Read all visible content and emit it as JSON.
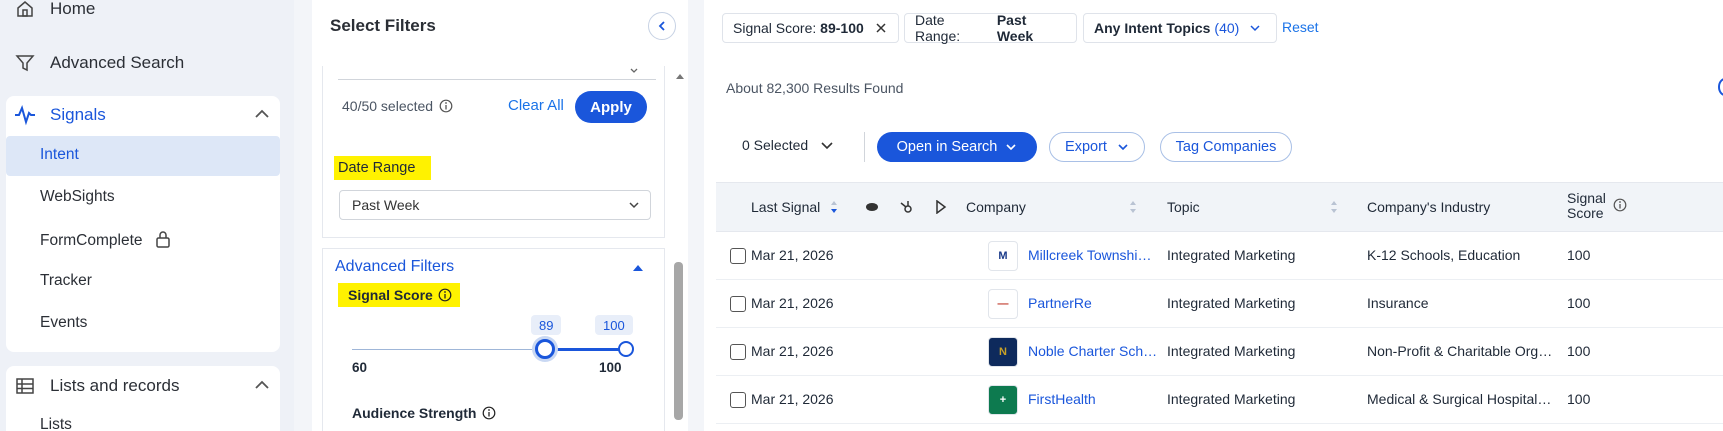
{
  "nav": {
    "home": "Home",
    "advanced_search": "Advanced Search",
    "signals": "Signals",
    "signal_items": [
      "Intent",
      "WebSights",
      "FormComplete",
      "Tracker",
      "Events"
    ],
    "lists_records": "Lists and records",
    "lists": "Lists",
    "accent": "#1a56db"
  },
  "filters": {
    "title": "Select Filters",
    "selected_count": "40/50 selected",
    "clear_all": "Clear All",
    "apply": "Apply",
    "date_range_label": "Date Range",
    "date_range_value": "Past Week",
    "advanced_filters": "Advanced Filters",
    "signal_score_label": "Signal Score",
    "signal_score_min": "89",
    "signal_score_max": "100",
    "scale_min": "60",
    "scale_max": "100",
    "audience_strength_label": "Audience Strength"
  },
  "chips": {
    "signal_score_key": "Signal Score:",
    "signal_score_val": "89-100",
    "date_range_key": "Date Range:",
    "date_range_val": "Past Week",
    "topics_key": "Any Intent Topics",
    "topics_count": "(40)",
    "reset": "Reset"
  },
  "results": "About 82,300 Results Found",
  "toolbar": {
    "selected": "0 Selected",
    "open_in_search": "Open in Search",
    "export": "Export",
    "tag_companies": "Tag Companies"
  },
  "table": {
    "headers": {
      "last_signal": "Last Signal",
      "company": "Company",
      "topic": "Topic",
      "industry": "Company's Industry",
      "score_line1": "Signal",
      "score_line2": "Score"
    },
    "rows": [
      {
        "date": "Mar 21, 2026",
        "company": "Millcreek Township Sc...",
        "topic": "Integrated Marketing",
        "industry": "K-12 Schools, Education",
        "score": "100",
        "logo": "M"
      },
      {
        "date": "Mar 21, 2026",
        "company": "PartnerRe",
        "topic": "Integrated Marketing",
        "industry": "Insurance",
        "score": "100",
        "logo": "—"
      },
      {
        "date": "Mar 21, 2026",
        "company": "Noble Charter Schools",
        "topic": "Integrated Marketing",
        "industry": "Non-Profit & Charitable Orga...",
        "score": "100",
        "logo": "N"
      },
      {
        "date": "Mar 21, 2026",
        "company": "FirstHealth",
        "topic": "Integrated Marketing",
        "industry": "Medical & Surgical Hospitals,...",
        "score": "100",
        "logo": "+"
      }
    ]
  }
}
